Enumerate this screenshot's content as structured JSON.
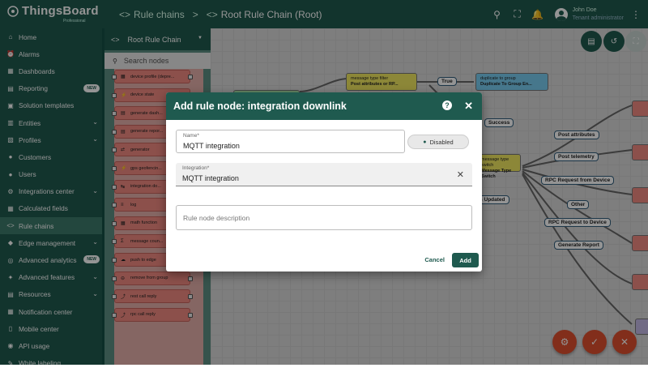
{
  "app": {
    "logo": "ThingsBoard",
    "edition": "Professional"
  },
  "breadcrumb": {
    "parent": "Rule chains",
    "separator": ">",
    "current": "Root Rule Chain (Root)"
  },
  "user": {
    "name": "John Doe",
    "role": "Tenant administrator"
  },
  "sidebar": {
    "items": [
      {
        "label": "Home",
        "icon": "home-icon"
      },
      {
        "label": "Alarms",
        "icon": "alarm-icon"
      },
      {
        "label": "Dashboards",
        "icon": "dashboard-icon"
      },
      {
        "label": "Reporting",
        "icon": "report-icon",
        "badge": "NEW"
      },
      {
        "label": "Solution templates",
        "icon": "template-icon"
      },
      {
        "label": "Entities",
        "icon": "entities-icon",
        "expandable": true
      },
      {
        "label": "Profiles",
        "icon": "profiles-icon",
        "expandable": true
      },
      {
        "label": "Customers",
        "icon": "customers-icon"
      },
      {
        "label": "Users",
        "icon": "users-icon"
      },
      {
        "label": "Integrations center",
        "icon": "integrations-icon",
        "expandable": true
      },
      {
        "label": "Calculated fields",
        "icon": "calc-icon"
      },
      {
        "label": "Rule chains",
        "icon": "rule-chain-icon",
        "active": true
      },
      {
        "label": "Edge management",
        "icon": "edge-icon",
        "expandable": true
      },
      {
        "label": "Advanced analytics",
        "icon": "analytics-icon",
        "badge": "NEW"
      },
      {
        "label": "Advanced features",
        "icon": "features-icon",
        "expandable": true
      },
      {
        "label": "Resources",
        "icon": "resources-icon",
        "expandable": true
      },
      {
        "label": "Notification center",
        "icon": "notification-icon"
      },
      {
        "label": "Mobile center",
        "icon": "mobile-icon"
      },
      {
        "label": "API usage",
        "icon": "api-icon"
      },
      {
        "label": "White labeling",
        "icon": "whitelabel-icon"
      }
    ]
  },
  "node_panel": {
    "title": "Root Rule Chain",
    "search_placeholder": "Search nodes",
    "nodes": [
      "device profile (depre...",
      "device state",
      "generate dash...",
      "generate repor...",
      "generator",
      "gps geofencin...",
      "integration do...",
      "log",
      "math function",
      "message coun...",
      "push to edge",
      "remove from group",
      "rest call reply",
      "rpc call reply"
    ]
  },
  "canvas": {
    "nodes": [
      {
        "type": "message type filter",
        "name": "Post attributes or RP..."
      },
      {
        "type": "duplicate to group",
        "name": "Duplicate To Group En..."
      },
      {
        "type": "message type switch",
        "name": "Message Type Switch"
      }
    ],
    "labels": [
      "True",
      "Success",
      "Post attributes",
      "Post telemetry",
      "RPC Request from Device",
      "Other",
      "RPC Request to Device",
      "Generate Report",
      "Attributes Updated"
    ]
  },
  "dialog": {
    "title": "Add rule node: integration downlink",
    "name_label": "Name*",
    "name_value": "MQTT integration",
    "toggle_label": "Disabled",
    "integration_label": "Integration*",
    "integration_value": "MQTT integration",
    "description_placeholder": "Rule node description",
    "cancel": "Cancel",
    "add": "Add"
  },
  "colors": {
    "primary": "#1f5a4f",
    "accent": "#e0502f"
  }
}
